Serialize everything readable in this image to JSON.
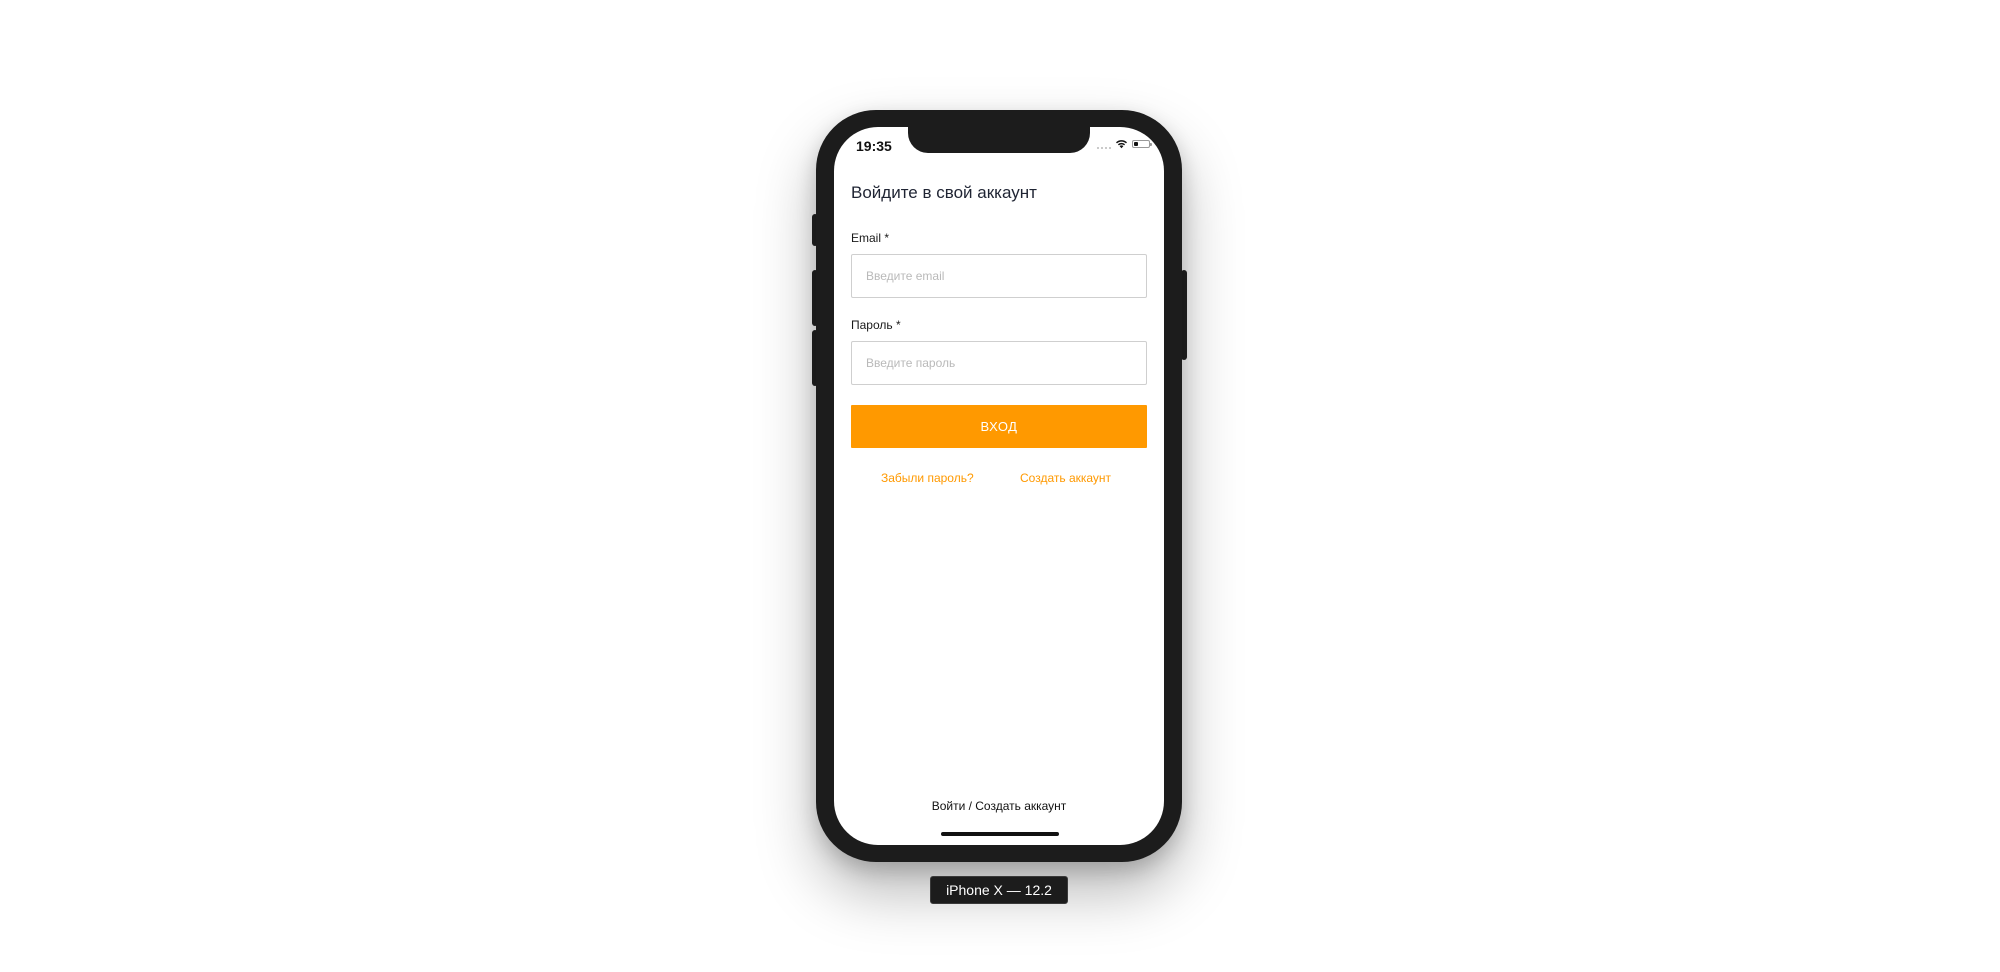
{
  "status_bar": {
    "time": "19:35"
  },
  "login_form": {
    "title": "Войдите в свой аккаунт",
    "email_label": "Email *",
    "email_placeholder": "Введите email",
    "email_value": "",
    "password_label": "Пароль *",
    "password_placeholder": "Введите пароль",
    "password_value": "",
    "submit_label": "ВХОД",
    "forgot_password_link": "Забыли пароль?",
    "create_account_link": "Создать аккаунт"
  },
  "footer": {
    "nav_text": "Войти / Создать аккаунт"
  },
  "simulator": {
    "device_label": "iPhone X — 12.2"
  },
  "colors": {
    "accent": "#ff9900",
    "frame": "#1c1c1c",
    "title_text": "#1f2433"
  },
  "icons": [
    "wifi-icon",
    "battery-icon",
    "cellular-signal-icon"
  ]
}
